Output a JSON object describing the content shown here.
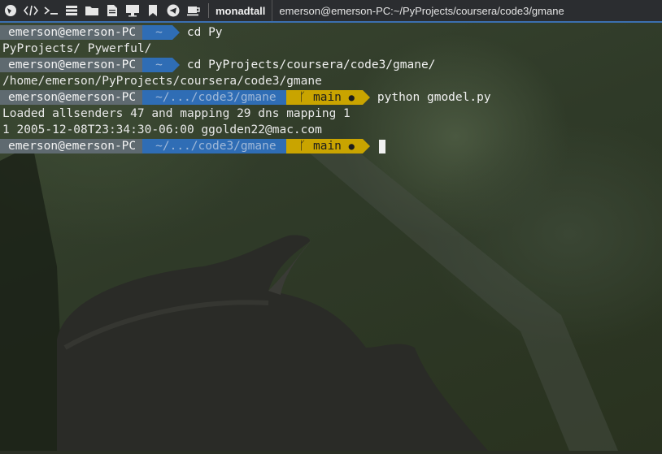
{
  "launcher": [
    {
      "icon": "browser-icon"
    },
    {
      "icon": "code-editor-icon"
    },
    {
      "icon": "terminal-icon"
    },
    {
      "icon": "database-icon"
    },
    {
      "icon": "folder-icon"
    },
    {
      "icon": "document-icon"
    },
    {
      "icon": "monitor-icon"
    },
    {
      "icon": "bookmark-icon"
    },
    {
      "icon": "telegram-icon"
    },
    {
      "icon": "coffee-icon"
    }
  ],
  "workspace": "monadtall",
  "window_title": "emerson@emerson-PC:~/PyProjects/coursera/code3/gmane",
  "terminal": {
    "user_host": "emerson@emerson-PC",
    "lines": {
      "p1_dir": "~",
      "p1_cmd": "cd Py",
      "out1": "PyProjects/ Pywerful/",
      "p2_dir": "~",
      "p2_cmd": "cd PyProjects/coursera/code3/gmane/",
      "out2": "/home/emerson/PyProjects/coursera/code3/gmane",
      "p3_dir": "~/.../code3/gmane",
      "p3_git": "main",
      "p3_cmd": "python gmodel.py",
      "out3": "Loaded allsenders 47 and mapping 29 dns mapping 1",
      "out4": "1 2005-12-08T23:34:30-06:00 ggolden22@mac.com",
      "p4_dir": "~/.../code3/gmane",
      "p4_git": "main"
    },
    "branch_glyph": "ᚴ",
    "dirty_glyph": "●"
  }
}
